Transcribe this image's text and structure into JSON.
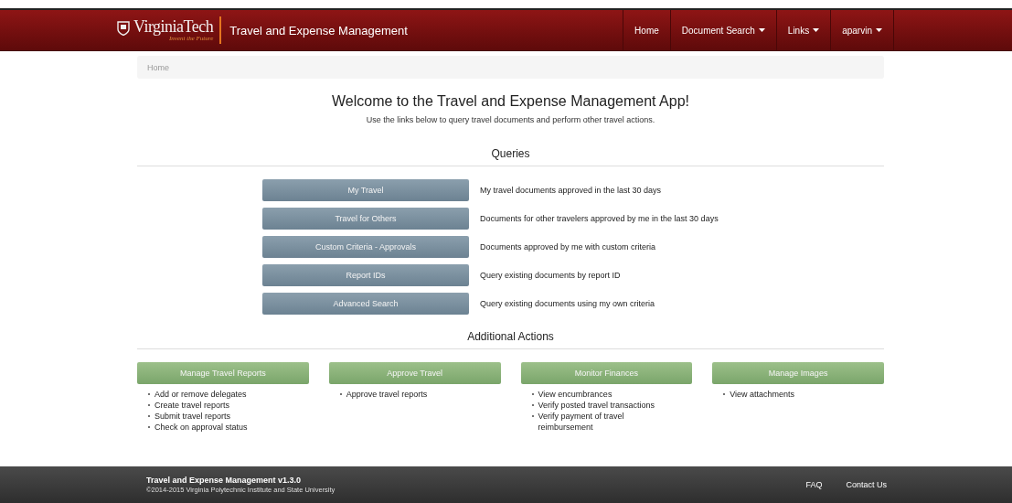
{
  "navbar": {
    "logo_text": "VirginiaTech",
    "logo_tagline": "Invent the Future",
    "app_title": "Travel and Expense Management",
    "items": [
      {
        "label": "Home",
        "dropdown": false
      },
      {
        "label": "Document Search",
        "dropdown": true
      },
      {
        "label": "Links",
        "dropdown": true
      },
      {
        "label": "aparvin",
        "dropdown": true
      }
    ]
  },
  "breadcrumb": [
    "Home"
  ],
  "welcome": {
    "title": "Welcome to the Travel and Expense Management App!",
    "subtitle": "Use the links below to query travel documents and perform other travel actions."
  },
  "queries": {
    "heading": "Queries",
    "rows": [
      {
        "button": "My Travel",
        "description": "My travel documents approved in the last 30 days"
      },
      {
        "button": "Travel for Others",
        "description": "Documents for other travelers approved by me in the last 30 days"
      },
      {
        "button": "Custom Criteria - Approvals",
        "description": "Documents approved by me with custom criteria"
      },
      {
        "button": "Report IDs",
        "description": "Query existing documents by report ID"
      },
      {
        "button": "Advanced Search",
        "description": "Query existing documents using my own criteria"
      }
    ]
  },
  "additional_actions": {
    "heading": "Additional Actions",
    "columns": [
      {
        "button": "Manage Travel Reports",
        "items": [
          "Add or remove delegates",
          "Create travel reports",
          "Submit travel reports",
          "Check on approval status"
        ]
      },
      {
        "button": "Approve Travel",
        "items": [
          "Approve travel reports"
        ]
      },
      {
        "button": "Monitor Finances",
        "items": [
          "View encumbrances",
          "Verify posted travel transactions",
          "Verify payment of travel reimbursement"
        ]
      },
      {
        "button": "Manage Images",
        "items": [
          "View attachments"
        ]
      }
    ]
  },
  "footer": {
    "title": "Travel and Expense Management v1.3.0",
    "copyright": "©2014-2015 Virginia Polytechnic Institute and State University",
    "links": [
      "FAQ",
      "Contact Us"
    ]
  }
}
